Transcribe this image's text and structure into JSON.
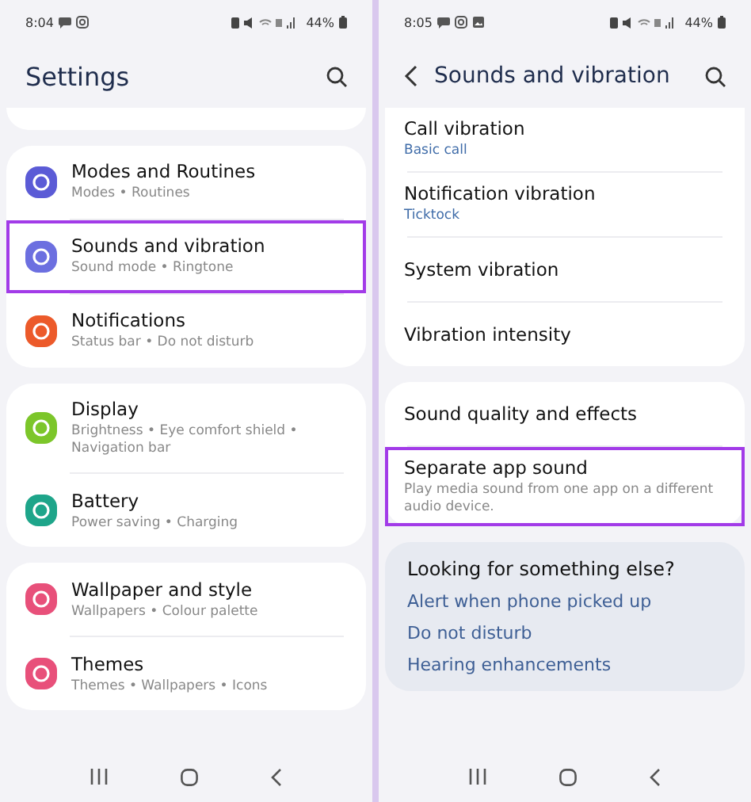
{
  "screens": [
    {
      "status_bar": {
        "time": "8:04",
        "battery": "44%"
      },
      "title": "Settings",
      "back_button": false,
      "top_stub": true,
      "groups": [
        [
          {
            "kind": "icon",
            "title": "Modes and Routines",
            "subtitle": "Modes • Routines",
            "color": "#5b5bd6",
            "highlighted": false
          },
          {
            "kind": "icon",
            "title": "Sounds and vibration",
            "subtitle": "Sound mode • Ringtone",
            "color": "#6c6fe0",
            "highlighted": true
          },
          {
            "kind": "icon",
            "title": "Notifications",
            "subtitle": "Status bar • Do not disturb",
            "color": "#ec5a2a",
            "highlighted": false
          }
        ],
        [
          {
            "kind": "icon",
            "title": "Display",
            "subtitle": "Brightness • Eye comfort shield • Navigation bar",
            "color": "#7cc62a",
            "highlighted": false
          },
          {
            "kind": "icon",
            "title": "Battery",
            "subtitle": "Power saving • Charging",
            "color": "#1ea58a",
            "highlighted": false
          }
        ],
        [
          {
            "kind": "icon",
            "title": "Wallpaper and style",
            "subtitle": "Wallpapers • Colour palette",
            "color": "#e8507a",
            "highlighted": false
          },
          {
            "kind": "icon",
            "title": "Themes",
            "subtitle": "Themes • Wallpapers • Icons",
            "color": "#e8507a",
            "highlighted": false
          }
        ]
      ]
    },
    {
      "status_bar": {
        "time": "8:05",
        "battery": "44%"
      },
      "title": "Sounds and vibration",
      "back_button": true,
      "top_stub": false,
      "groups": [
        [
          {
            "kind": "value",
            "title": "Call vibration",
            "subtitle": "Basic call",
            "highlighted": false
          },
          {
            "kind": "value",
            "title": "Notification vibration",
            "subtitle": "Ticktock",
            "highlighted": false
          },
          {
            "kind": "plain",
            "title": "System vibration",
            "highlighted": false
          },
          {
            "kind": "plain",
            "title": "Vibration intensity",
            "highlighted": false
          }
        ],
        [
          {
            "kind": "plain",
            "title": "Sound quality and effects",
            "highlighted": false
          },
          {
            "kind": "description",
            "title": "Separate app sound",
            "subtitle": "Play media sound from one app on a different audio device.",
            "highlighted": true
          }
        ]
      ],
      "suggestions": {
        "title": "Looking for something else?",
        "links": [
          "Alert when phone picked up",
          "Do not disturb",
          "Hearing enhancements"
        ]
      }
    }
  ]
}
